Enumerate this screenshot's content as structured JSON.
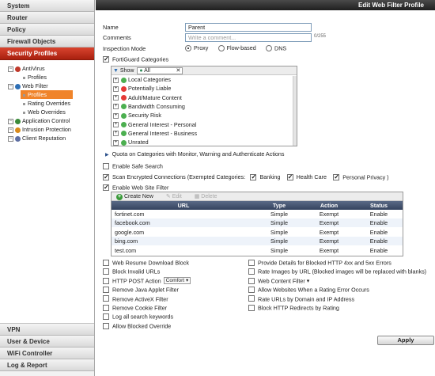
{
  "sidebar": {
    "top_items": [
      "System",
      "Router",
      "Policy",
      "Firewall Objects"
    ],
    "active_section": "Security Profiles",
    "tree": [
      {
        "label": "AntiVirus",
        "level": 0,
        "kind": "parent",
        "icon_color": "#c0392b"
      },
      {
        "label": "Profiles",
        "level": 1,
        "kind": "leaf"
      },
      {
        "label": "Web Filter",
        "level": 0,
        "kind": "parent",
        "icon_color": "#2e6fb5"
      },
      {
        "label": "Profiles",
        "level": 1,
        "kind": "leaf",
        "selected": true
      },
      {
        "label": "Rating Overrides",
        "level": 1,
        "kind": "leaf"
      },
      {
        "label": "Web Overrides",
        "level": 1,
        "kind": "leaf"
      },
      {
        "label": "Application Control",
        "level": 0,
        "kind": "parent",
        "icon_color": "#3a8a3a"
      },
      {
        "label": "Intrusion Protection",
        "level": 0,
        "kind": "parent",
        "icon_color": "#d98a1a"
      },
      {
        "label": "Client Reputation",
        "level": 0,
        "kind": "parent",
        "icon_color": "#5e6fa3"
      }
    ],
    "bottom_items": [
      "VPN",
      "User & Device",
      "WiFi Controller",
      "Log & Report"
    ]
  },
  "main": {
    "title": "Edit Web Filter Profile",
    "name_label": "Name",
    "name_value": "Parent",
    "comments_label": "Comments",
    "comments_placeholder": "Write a comment...",
    "comments_counter": "0/255",
    "inspection_label": "Inspection Mode",
    "inspection_options": [
      {
        "label": "Proxy",
        "selected": true
      },
      {
        "label": "Flow-based",
        "selected": false
      },
      {
        "label": "DNS",
        "selected": false
      }
    ],
    "fortiguard_label": "FortiGuard Categories",
    "show_label": "Show",
    "show_value": "All",
    "categories": [
      {
        "label": "Local Categories",
        "color": "#4caf50"
      },
      {
        "label": "Potentially Liable",
        "color": "#e53935"
      },
      {
        "label": "Adult/Mature Content",
        "color": "#e53935"
      },
      {
        "label": "Bandwidth Consuming",
        "color": "#4caf50"
      },
      {
        "label": "Security Risk",
        "color": "#4caf50"
      },
      {
        "label": "General Interest - Personal",
        "color": "#4caf50"
      },
      {
        "label": "General Interest - Business",
        "color": "#4caf50"
      },
      {
        "label": "Unrated",
        "color": "#4caf50"
      }
    ],
    "quota_label": "Quota on Categories with Monitor, Warning and Authenticate Actions",
    "safe_search_label": "Enable Safe Search",
    "scan_label": "Scan Encrypted Connections (Exempted Categories:",
    "scan_categories": [
      "Banking",
      "Health Care",
      "Personal Privacy )"
    ],
    "site_filter_label": "Enable Web Site Filter",
    "toolbar": {
      "create": "Create New",
      "edit": "Edit",
      "delete": "Delete"
    },
    "url_columns": [
      "URL",
      "Type",
      "Action",
      "Status"
    ],
    "url_rows": [
      [
        "fortinet.com",
        "Simple",
        "Exempt",
        "Enable"
      ],
      [
        "facebook.com",
        "Simple",
        "Exempt",
        "Enable"
      ],
      [
        "google.com",
        "Simple",
        "Exempt",
        "Enable"
      ],
      [
        "bing.com",
        "Simple",
        "Exempt",
        "Enable"
      ],
      [
        "test.com",
        "Simple",
        "Exempt",
        "Enable"
      ]
    ],
    "options_left": [
      "Web Resume Download Block",
      "Block Invalid URLs",
      "HTTP POST Action",
      "Remove Java Applet Filter",
      "Remove ActiveX Filter",
      "Remove Cookie Filter",
      "Log all search keywords",
      "Allow Blocked Override"
    ],
    "post_action_value": "Comfort",
    "options_right": [
      "Provide Details for Blocked HTTP 4xx and 5xx Errors",
      "Rate Images by URL (Blocked images will be replaced with blanks)",
      "Web Content Filter",
      "Allow Websites When a Rating Error Occurs",
      "Rate URLs by Domain and IP Address",
      "Block HTTP Redirects by Rating"
    ],
    "apply_label": "Apply"
  }
}
